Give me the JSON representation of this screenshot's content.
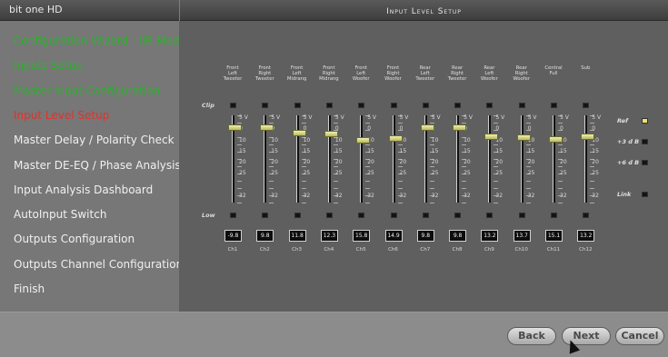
{
  "app": {
    "title": "bit one HD"
  },
  "screen": {
    "title": "Input Level Setup"
  },
  "sidebar": {
    "items": [
      {
        "label": "Configuration Wizard - IIR Mode",
        "state": "done"
      },
      {
        "label": "Inputs Setup",
        "state": "done"
      },
      {
        "label": "Master Input Configuration",
        "state": "done"
      },
      {
        "label": "Input Level Setup",
        "state": "current"
      },
      {
        "label": "Master Delay / Polarity Check",
        "state": "todo"
      },
      {
        "label": "Master DE-EQ / Phase Analysis",
        "state": "todo"
      },
      {
        "label": "Input Analysis Dashboard",
        "state": "todo"
      },
      {
        "label": "AutoInput Switch",
        "state": "todo"
      },
      {
        "label": "Outputs Configuration",
        "state": "todo"
      },
      {
        "label": "Outputs Channel Configuration",
        "state": "todo"
      },
      {
        "label": "Finish",
        "state": "todo"
      }
    ]
  },
  "mixer": {
    "clip_label": "Clip",
    "low_label": "Low",
    "scale": [
      "5 V",
      "0",
      "10",
      "15",
      "20",
      "25",
      "32"
    ],
    "channels": [
      {
        "head": [
          "Front",
          "Left",
          "Tweeter"
        ],
        "value": "-9.8",
        "name": "Ch1",
        "level": 0.0
      },
      {
        "head": [
          "Front",
          "Right",
          "Tweeter"
        ],
        "value": "9.8",
        "name": "Ch2",
        "level": 0.0
      },
      {
        "head": [
          "Front",
          "Left",
          "Midrang"
        ],
        "value": "11.8",
        "name": "Ch3",
        "level": 0.12
      },
      {
        "head": [
          "Front",
          "Right",
          "Midrang"
        ],
        "value": "12.3",
        "name": "Ch4",
        "level": 0.14
      },
      {
        "head": [
          "Front",
          "Left",
          "Woofer"
        ],
        "value": "15.8",
        "name": "Ch5",
        "level": 0.29
      },
      {
        "head": [
          "Front",
          "Right",
          "Woofer"
        ],
        "value": "14.9",
        "name": "Ch6",
        "level": 0.25
      },
      {
        "head": [
          "Rear",
          "Left",
          "Tweeter"
        ],
        "value": "9.8",
        "name": "Ch7",
        "level": 0.0
      },
      {
        "head": [
          "Rear",
          "Right",
          "Tweeter"
        ],
        "value": "9.8",
        "name": "Ch8",
        "level": 0.0
      },
      {
        "head": [
          "Rear",
          "Left",
          "Woofer"
        ],
        "value": "13.2",
        "name": "Ch9",
        "level": 0.2
      },
      {
        "head": [
          "Rear",
          "Right",
          "Woofer"
        ],
        "value": "13.7",
        "name": "Ch10",
        "level": 0.22
      },
      {
        "head": [
          "Central",
          "Full",
          ""
        ],
        "value": "15.1",
        "name": "Ch11",
        "level": 0.26
      },
      {
        "head": [
          "Sub",
          "",
          ""
        ],
        "value": "13.2",
        "name": "Ch12",
        "level": 0.2
      }
    ]
  },
  "right_controls": {
    "ref": {
      "label": "Ref",
      "on": true
    },
    "plus3": {
      "label": "+3 d B",
      "on": false
    },
    "plus6": {
      "label": "+6 d B",
      "on": false
    },
    "link": {
      "label": "Link",
      "on": false
    }
  },
  "footer": {
    "back": "Back",
    "next": "Next",
    "cancel": "Cancel"
  }
}
